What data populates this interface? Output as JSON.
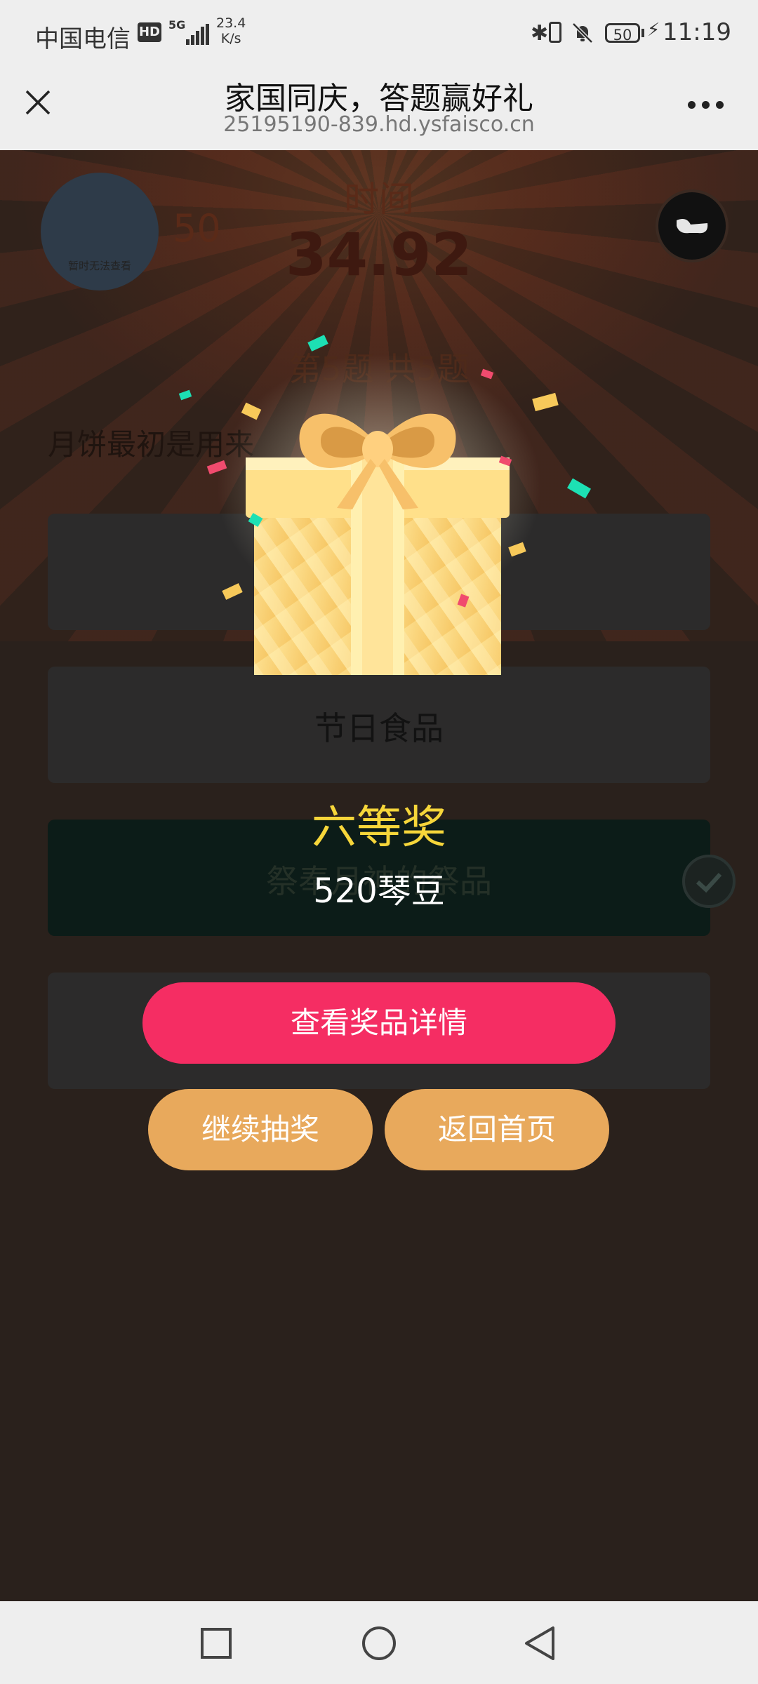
{
  "status_bar": {
    "carrier": "中国电信",
    "hd": "HD",
    "network": "5G",
    "speed_value": "23.4",
    "speed_unit": "K/s",
    "battery": "50",
    "time": "11:19"
  },
  "title_bar": {
    "title": "家国同庆，答题赢好礼",
    "url": "25195190-839.hd.ysfaisco.cn"
  },
  "game": {
    "avatar_caption": "暂时无法查看",
    "score": "50",
    "time_label": "时间",
    "time_value": "34.92",
    "progress": "第5题  共5题",
    "question": "月饼最初是用来",
    "options": [
      "",
      "节日食品",
      "祭奉月神的祭品",
      ""
    ]
  },
  "popup": {
    "prize_level": "六等奖",
    "prize_name": "520琴豆",
    "detail_button": "查看奖品详情",
    "continue_button": "继续抽奖",
    "home_button": "返回首页"
  },
  "colors": {
    "accent_pink": "#f52d63",
    "accent_orange": "#e8a95c",
    "prize_yellow": "#f6d63a"
  }
}
